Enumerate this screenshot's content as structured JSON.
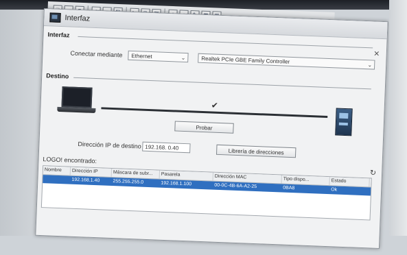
{
  "dialog": {
    "title": "Interfaz",
    "close_glyph": "×",
    "interface_group": "Interfaz",
    "connect_via_label": "Conectar mediante",
    "connect_via_value": "Ethernet",
    "adapter_value": "Realtek PCIe GBE Family Controller",
    "target_group": "Destino",
    "check_glyph": "✔",
    "test_button": "Probar",
    "device_ip_label": "Dirección IP de destino",
    "device_ip_value": "192.168. 0.40",
    "browse_button": "Librería de direcciones",
    "found_label": "LOGO! encontrado:",
    "table": {
      "headers": [
        "Nombre",
        "Dirección IP",
        "Máscara de subr...",
        "Pasarela",
        "Dirección MAC",
        "Tipo dispo...",
        "Estado"
      ],
      "rows": [
        [
          "",
          "192.168.1.40",
          "255.255.255.0",
          "192.168.1.100",
          "00-0C-4B-6A-A2-25",
          "0BA8",
          "Ok"
        ]
      ]
    },
    "refresh_glyph": "↻"
  },
  "toolbar": {
    "icons": [
      "new-icon",
      "open-icon",
      "save-icon",
      "print-icon",
      "zoom-in-icon",
      "zoom-out-icon",
      "cut-icon",
      "copy-icon",
      "paste-icon",
      "upload-icon",
      "download-icon",
      "edit-icon",
      "grid-icon",
      "table-icon"
    ]
  },
  "colors": {
    "selection": "#2f6fc0",
    "dialog_bg": "#f1f2f3"
  }
}
